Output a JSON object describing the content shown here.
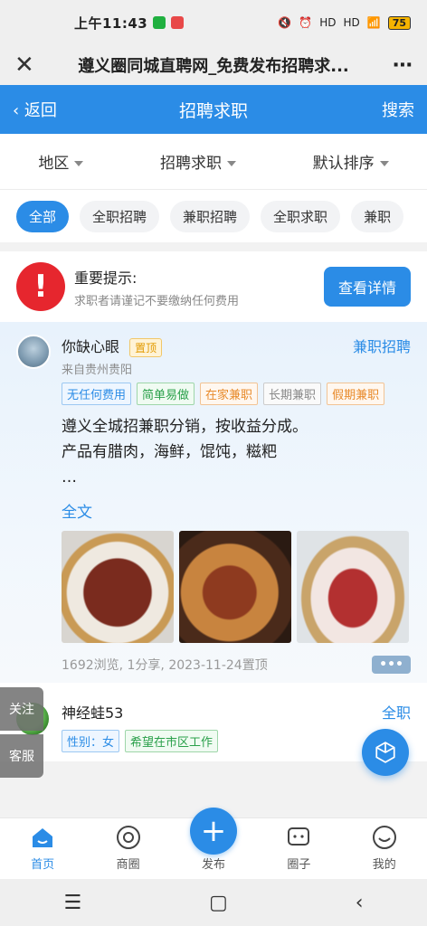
{
  "status": {
    "time": "上午11:43",
    "battery": "75",
    "signal1": "HD",
    "signal2": "HD"
  },
  "window": {
    "title": "遵义圈同城直聘网_免费发布招聘求..."
  },
  "header": {
    "back": "返回",
    "title": "招聘求职",
    "search": "搜索"
  },
  "filters": [
    {
      "label": "地区"
    },
    {
      "label": "招聘求职"
    },
    {
      "label": "默认排序"
    }
  ],
  "pills": [
    "全部",
    "全职招聘",
    "兼职招聘",
    "全职求职",
    "兼职"
  ],
  "notice": {
    "title": "重要提示:",
    "desc": "求职者请谨记不要缴纳任何费用",
    "button": "查看详情"
  },
  "post1": {
    "name": "你缺心眼",
    "badge": "置顶",
    "from": "来自贵州贵阳",
    "category": "兼职招聘",
    "tags": [
      "无任何费用",
      "简单易做",
      "在家兼职",
      "长期兼职",
      "假期兼职"
    ],
    "line1": "遵义全城招兼职分销，按收益分成。",
    "line2": "产品有腊肉，海鲜，馄饨，糍粑",
    "ellipsis": "…",
    "fulltext": "全文",
    "stats": "1692浏览, 1分享, 2023-11-24置顶",
    "more": "•••"
  },
  "post2": {
    "name": "神经蛙53",
    "category": "全职",
    "tags": [
      "性别：女",
      "希望在市区工作"
    ]
  },
  "side": {
    "follow": "关注",
    "service": "客服"
  },
  "tabs": [
    {
      "label": "首页"
    },
    {
      "label": "商圈"
    },
    {
      "label": "发布"
    },
    {
      "label": "圈子"
    },
    {
      "label": "我的"
    }
  ],
  "colors": {
    "accent": "#2b8ce6",
    "warn": "#e6262e"
  }
}
